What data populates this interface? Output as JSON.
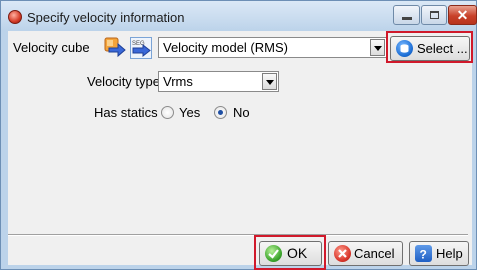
{
  "window": {
    "title": "Specify velocity information",
    "title_icon": "app-icon",
    "min_glyph": "minimize",
    "max_glyph": "maximize",
    "close_glyph": "✕"
  },
  "velocity_cube": {
    "label": "Velocity cube",
    "load_icon": "load-arrow-icon",
    "segy_icon": "segy-icon",
    "segy_text": "SEG",
    "selected": "Velocity model (RMS)",
    "select_button": "Select ..."
  },
  "velocity_type": {
    "label": "Velocity type",
    "selected": "Vrms"
  },
  "has_statics": {
    "label": "Has statics",
    "options": [
      "Yes",
      "No"
    ],
    "selected": "No"
  },
  "footer": {
    "ok": "OK",
    "cancel": "Cancel",
    "help": "Help"
  },
  "colors": {
    "highlight": "#d0192b",
    "title_bar": "#bcd3ea",
    "dialog_bg": "#f0f0f0"
  }
}
